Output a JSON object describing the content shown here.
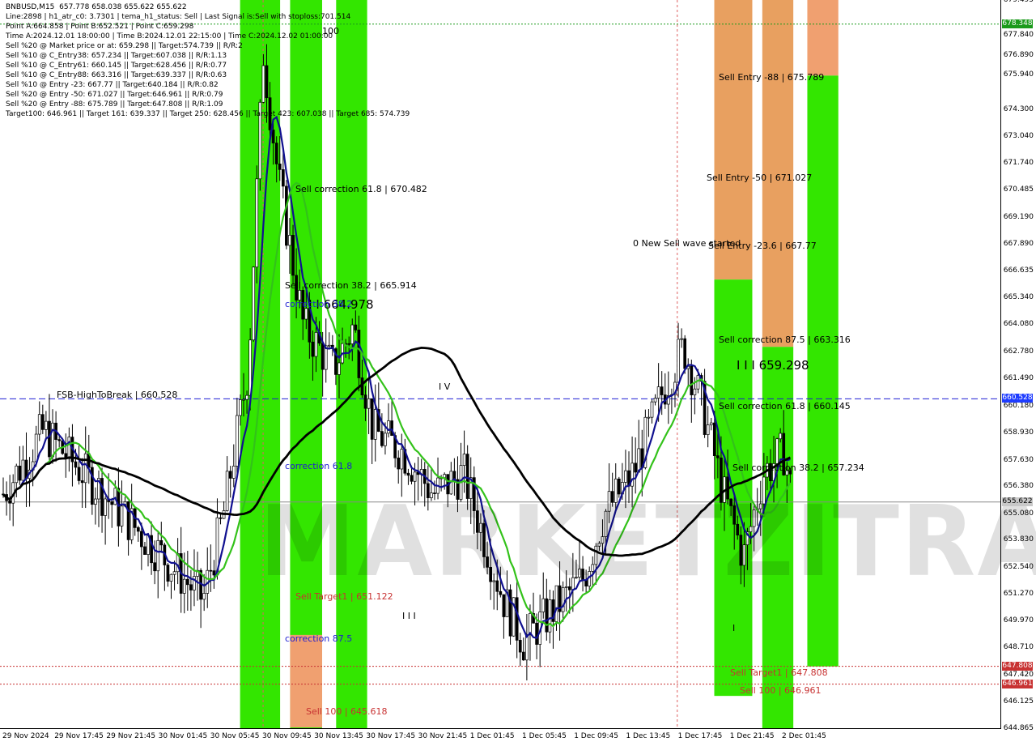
{
  "header": {
    "lines": [
      "BNBUSD,M15  657.778 658.038 655.622 655.622",
      "Line:2898 | h1_atr_c0: 3.7301 | tema_h1_status: Sell | Last Signal is:Sell with stoploss:701.514",
      "Point A:664.858 | Point B:652.521 | Point C:659.298",
      "Time A:2024.12.01 18:00:00 | Time B:2024.12.01 22:15:00 | Time C:2024.12.02 01:00:00",
      "Sell %20 @ Market price or at: 659.298 || Target:574.739 || R/R:2",
      "Sell %10 @ C_Entry38: 657.234 || Target:607.038 || R/R:1.13",
      "Sell %10 @ C_Entry61: 660.145 || Target:628.456 || R/R:0.77",
      "Sell %10 @ C_Entry88: 663.316 || Target:639.337 || R/R:0.63",
      "Sell %10 @ Entry -23: 667.77 || Target:640.184 || R/R:0.82",
      "Sell %20 @ Entry -50: 671.027 || Target:646.961 || R/R:0.79",
      "Sell %20 @ Entry -88: 675.789 || Target:647.808 || R/R:1.09",
      "Target100: 646.961 || Target 161: 639.337 || Target 250: 628.456 || Target 423: 607.038 || Target 685: 574.739"
    ]
  },
  "watermark": "MARKETZITRADE",
  "chart_data": {
    "type": "candlestick",
    "symbol": "BNBUSD",
    "timeframe": "M15",
    "ylim": [
      644.865,
      679.495
    ],
    "y_ticks": [
      "679.495",
      "677.840",
      "676.890",
      "675.940",
      "674.300",
      "673.040",
      "671.740",
      "670.485",
      "669.190",
      "667.890",
      "666.635",
      "665.340",
      "664.080",
      "662.780",
      "661.490",
      "660.180",
      "658.930",
      "657.630",
      "656.380",
      "655.080",
      "653.830",
      "652.540",
      "651.270",
      "649.970",
      "648.710",
      "647.420",
      "646.125",
      "644.865"
    ],
    "x_ticks": [
      "29 Nov 2024",
      "29 Nov 17:45",
      "29 Nov 21:45",
      "30 Nov 01:45",
      "30 Nov 05:45",
      "30 Nov 09:45",
      "30 Nov 13:45",
      "30 Nov 17:45",
      "30 Nov 21:45",
      "1 Dec 01:45",
      "1 Dec 05:45",
      "1 Dec 09:45",
      "1 Dec 13:45",
      "1 Dec 17:45",
      "1 Dec 21:45",
      "2 Dec 01:45"
    ],
    "price_tags": [
      {
        "value": 678.348,
        "label": "678.348",
        "color": "#1a9a1a"
      },
      {
        "value": 660.528,
        "label": "660.528",
        "color": "#1e3cff"
      },
      {
        "value": 655.622,
        "label": "655.622",
        "color": "#c8c8c8",
        "text_color": "#000000"
      },
      {
        "value": 647.808,
        "label": "647.808",
        "color": "#c83232"
      },
      {
        "value": 646.961,
        "label": "646.961",
        "color": "#c83232"
      }
    ],
    "hlines": [
      {
        "value": 660.528,
        "color": "#1e1ed2",
        "style": "dashed"
      },
      {
        "value": 655.622,
        "color": "#888888",
        "style": "solid"
      },
      {
        "value": 647.808,
        "color": "#c83232",
        "style": "dotted"
      },
      {
        "value": 646.961,
        "color": "#c83232",
        "style": "dotted"
      },
      {
        "value": 678.348,
        "color": "#1a9a1a",
        "style": "dotted"
      }
    ],
    "annotations": [
      {
        "text": "FSB-HighToBreak | 660.528",
        "x_hint": "29 Nov 17:45",
        "y": 660.7,
        "color": "#000000"
      },
      {
        "text": "Sell correction 61.8 | 670.482",
        "y": 670.48,
        "color": "#000000"
      },
      {
        "text": "I I I 664.978",
        "y": 664.98,
        "color": "#000000",
        "big": true
      },
      {
        "text": "Sell correction 38.2 | 665.914",
        "y": 665.91,
        "color": "#000000"
      },
      {
        "text": "correction 38.2",
        "y": 665.0,
        "color": "#1e1ed2"
      },
      {
        "text": "correction 61.8",
        "y": 657.3,
        "color": "#1e1ed2"
      },
      {
        "text": "correction 87.5",
        "y": 649.1,
        "color": "#1e1ed2"
      },
      {
        "text": "Sell Target1 | 651.122",
        "y": 651.12,
        "color": "#c83232"
      },
      {
        "text": "Sell 100 | 645.618",
        "y": 645.62,
        "color": "#c83232"
      },
      {
        "text": "I V",
        "y": 661.1,
        "color": "#000000"
      },
      {
        "text": "I I I",
        "y": 650.2,
        "color": "#000000"
      },
      {
        "text": "0 New Sell wave started",
        "y": 667.9,
        "color": "#000000"
      },
      {
        "text": "Sell Entry -88 | 675.789",
        "y": 675.79,
        "color": "#000000"
      },
      {
        "text": "Sell Entry -50 | 671.027",
        "y": 671.03,
        "color": "#000000"
      },
      {
        "text": "Sell Entry -23.6 | 667.77",
        "y": 667.77,
        "color": "#000000"
      },
      {
        "text": "Sell correction 87.5 | 663.316",
        "y": 663.32,
        "color": "#000000"
      },
      {
        "text": "I I I 659.298",
        "y": 662.1,
        "color": "#000000",
        "big": true
      },
      {
        "text": "Sell correction 61.8 | 660.145",
        "y": 660.15,
        "color": "#000000"
      },
      {
        "text": "Sell correction 38.2 | 657.234",
        "y": 657.23,
        "color": "#000000"
      },
      {
        "text": "Sell Target1 | 647.808",
        "y": 647.5,
        "color": "#c83232"
      },
      {
        "text": "Sell 100 | 646.961",
        "y": 646.65,
        "color": "#c83232"
      },
      {
        "text": "100",
        "y": 678.0,
        "color": "#000000"
      },
      {
        "text": "I",
        "y": 649.6,
        "color": "#000000"
      }
    ],
    "zones": [
      {
        "from_pos": 0.24,
        "to_pos": 0.28,
        "color": "#33e600",
        "label": "green-zone-1"
      },
      {
        "from_pos": 0.29,
        "to_pos": 0.322,
        "color": "#33e600",
        "label": "green-zone-2"
      },
      {
        "from_pos": 0.336,
        "to_pos": 0.367,
        "color": "#33e600",
        "label": "green-zone-3"
      },
      {
        "from_pos": 0.29,
        "to_pos": 0.322,
        "color": "#f0a070",
        "y_from": 644.9,
        "y_to": 649.3,
        "label": "orange-zone-2"
      },
      {
        "from_pos": 0.714,
        "to_pos": 0.752,
        "color": "#e8a060",
        "y_from": 666.2,
        "y_to": 679.495,
        "label": "orange-zone-a"
      },
      {
        "from_pos": 0.714,
        "to_pos": 0.752,
        "color": "#33e600",
        "y_from": 646.4,
        "y_to": 666.2,
        "label": "green-zone-a"
      },
      {
        "from_pos": 0.762,
        "to_pos": 0.793,
        "color": "#e8a060",
        "y_from": 663.0,
        "y_to": 679.495,
        "label": "orange-zone-b"
      },
      {
        "from_pos": 0.762,
        "to_pos": 0.793,
        "color": "#33e600",
        "y_from": 644.865,
        "y_to": 663.0,
        "label": "green-zone-b"
      },
      {
        "from_pos": 0.807,
        "to_pos": 0.838,
        "color": "#f0a070",
        "y_from": 675.9,
        "y_to": 679.495,
        "label": "orange-zone-c"
      },
      {
        "from_pos": 0.807,
        "to_pos": 0.838,
        "color": "#33e600",
        "y_from": 647.8,
        "y_to": 675.9,
        "label": "green-zone-c"
      }
    ]
  }
}
